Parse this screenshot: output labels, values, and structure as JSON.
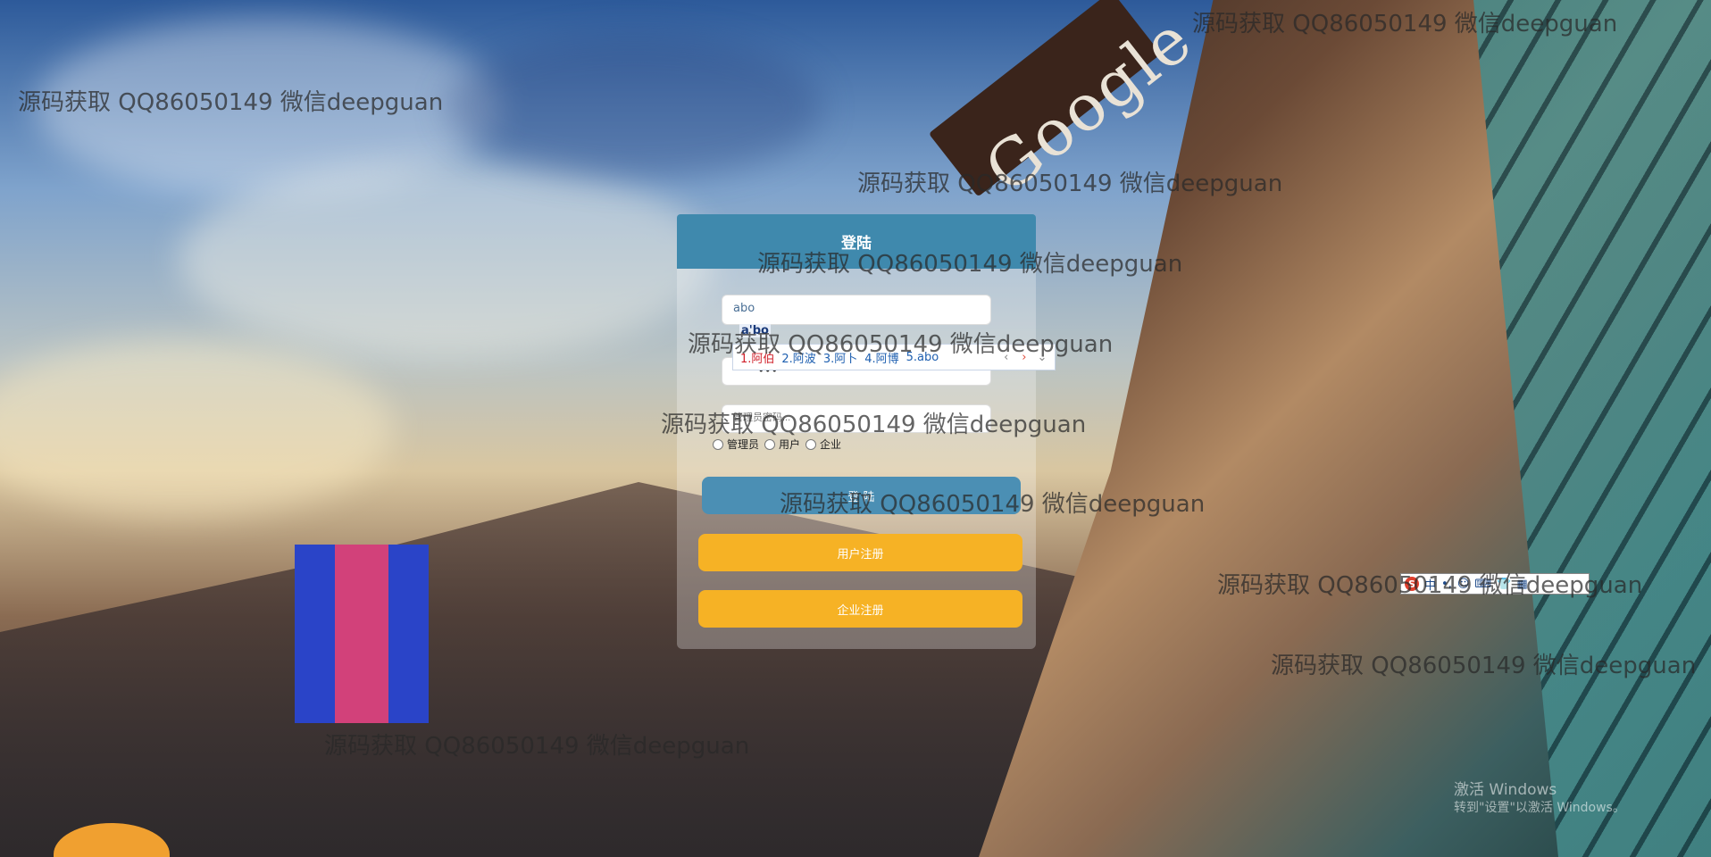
{
  "login": {
    "title": "登陆",
    "username_value": "abo",
    "password_mask": "•••",
    "confirm_placeholder": "管理员密码...",
    "roles": [
      "管理员",
      "用户",
      "企业"
    ],
    "login_button": "登 陆",
    "user_register_button": "用户注册",
    "enterprise_register_button": "企业注册"
  },
  "ime": {
    "composition": "a'bo",
    "candidates": [
      "1.阿伯",
      "2.阿波",
      "3.阿卜",
      "4.阿博",
      "5.abo"
    ],
    "prev_arrow": "‹",
    "next_arrow": "›",
    "chevron": "⌄",
    "status_bar": [
      "S",
      "中",
      "•,",
      "☺",
      "⌨",
      "👕",
      "▦"
    ]
  },
  "watermark": "源码获取 QQ86050149 微信deepguan",
  "windows_activation": {
    "line1": "激活 Windows",
    "line2": "转到\"设置\"以激活 Windows。"
  },
  "colors": {
    "header": "#3f89ad",
    "login_button": "#4b8fb4",
    "register_button": "#f6b225"
  }
}
